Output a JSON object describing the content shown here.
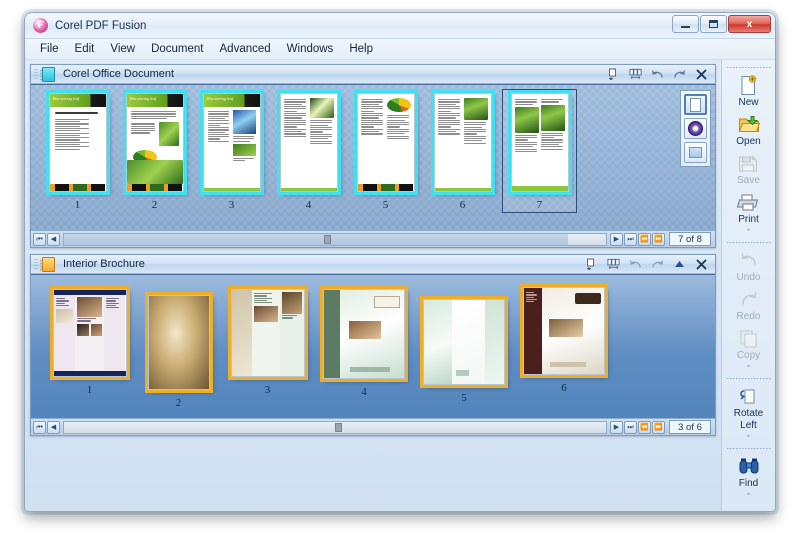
{
  "window": {
    "title": "Corel PDF Fusion",
    "logo_icon": "corel-logo-icon",
    "buttons": {
      "minimize": {
        "name": "minimize-button",
        "label": "–"
      },
      "maximize": {
        "name": "maximize-button",
        "label": "□"
      },
      "close": {
        "name": "close-button",
        "label": "x"
      }
    }
  },
  "menubar": {
    "items": [
      {
        "label": "File"
      },
      {
        "label": "Edit"
      },
      {
        "label": "View"
      },
      {
        "label": "Document"
      },
      {
        "label": "Advanced"
      },
      {
        "label": "Windows"
      },
      {
        "label": "Help"
      }
    ]
  },
  "panels": [
    {
      "title": "Corel Office Document",
      "icon": "document-icon-cyan",
      "tools": [
        {
          "name": "single-page-view-icon",
          "label": "Single page view"
        },
        {
          "name": "multi-page-view-icon",
          "label": "Multi page view"
        },
        {
          "name": "undo-icon",
          "label": "Undo"
        },
        {
          "name": "redo-icon",
          "label": "Redo"
        },
        {
          "name": "close-panel-icon",
          "label": "Close"
        }
      ],
      "view_modes": [
        {
          "name": "page-view-mode",
          "active": true
        },
        {
          "name": "flip-view-mode",
          "active": false
        },
        {
          "name": "thumbnail-view-mode",
          "active": false
        }
      ],
      "pages": [
        {
          "number": "1"
        },
        {
          "number": "2"
        },
        {
          "number": "3"
        },
        {
          "number": "4"
        },
        {
          "number": "5"
        },
        {
          "number": "6"
        },
        {
          "number": "7",
          "selected": true
        }
      ],
      "status": {
        "page_indicator": "7 of 8",
        "first_label": "⏮",
        "prev_label": "◀",
        "next_label": "▶",
        "last_label": "⏭",
        "rewind_label": "⏪",
        "forward_label": "⏩"
      }
    },
    {
      "title": "Interior Brochure",
      "icon": "document-icon-orange",
      "tools": [
        {
          "name": "single-page-view-icon",
          "label": "Single page view"
        },
        {
          "name": "multi-page-view-icon",
          "label": "Multi page view"
        },
        {
          "name": "undo-icon",
          "label": "Undo"
        },
        {
          "name": "redo-icon",
          "label": "Redo"
        },
        {
          "name": "collapse-panel-icon",
          "label": "Collapse"
        },
        {
          "name": "close-panel-icon",
          "label": "Close"
        }
      ],
      "pages": [
        {
          "number": "1"
        },
        {
          "number": "2"
        },
        {
          "number": "3"
        },
        {
          "number": "4"
        },
        {
          "number": "5"
        },
        {
          "number": "6"
        }
      ],
      "status": {
        "page_indicator": "3 of 6",
        "first_label": "⏮",
        "prev_label": "◀",
        "next_label": "▶",
        "last_label": "⏭",
        "rewind_label": "⏪",
        "forward_label": "⏩"
      }
    }
  ],
  "rail": {
    "groups": [
      {
        "buttons": [
          {
            "label": "New",
            "icon": "new-document-icon",
            "disabled": false
          },
          {
            "label": "Open",
            "icon": "open-folder-icon",
            "disabled": false
          },
          {
            "label": "Save",
            "icon": "save-icon",
            "disabled": true
          },
          {
            "label": "Print",
            "icon": "printer-icon",
            "disabled": false
          }
        ],
        "more": "ˇ"
      },
      {
        "buttons": [
          {
            "label": "Undo",
            "icon": "undo-arrow-icon",
            "disabled": true
          },
          {
            "label": "Redo",
            "icon": "redo-arrow-icon",
            "disabled": true
          },
          {
            "label": "Copy",
            "icon": "copy-icon",
            "disabled": true
          }
        ],
        "more": "ˇ"
      },
      {
        "buttons": [
          {
            "label": "Rotate\nLeft",
            "label_line1": "Rotate",
            "label_line2": "Left",
            "icon": "rotate-left-icon",
            "disabled": false
          }
        ],
        "more": "ˇ"
      },
      {
        "buttons": [
          {
            "label": "Find",
            "icon": "binoculars-icon",
            "disabled": false
          }
        ],
        "more": "ˇ"
      }
    ]
  },
  "colors": {
    "accent_cyan": "#3fe0f2",
    "accent_gold": "#efae2a",
    "strip_blue": "#5f8dc2",
    "chrome_blue": "#d9e6f4"
  }
}
